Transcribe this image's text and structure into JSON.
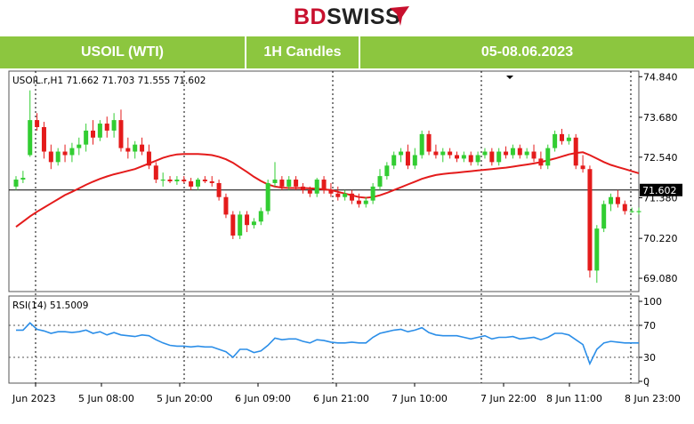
{
  "logo": {
    "part1": "BD",
    "part2": "SWISS"
  },
  "header": {
    "symbol": "USOIL (WTI)",
    "timeframe": "1H Candles",
    "date_range": "05-08.06.2023"
  },
  "colors": {
    "header_bg": "#8cc63f",
    "bull": "#32cd32",
    "bear": "#e41b1b",
    "ma": "#e41b1b",
    "rsi": "#2b8ee8",
    "price_line": "#000000"
  },
  "chart_data": [
    {
      "type": "candlestick",
      "title": "USOIL.r,H1  71.662 71.703 71.555 71.602",
      "current_price": 71.602,
      "current_price_label": "71.602",
      "ylim": [
        68.7,
        75.0
      ],
      "y_ticks": [
        "74.840",
        "73.680",
        "72.540",
        "71.380",
        "70.220",
        "69.080"
      ],
      "x_ticks": [
        "Jun 2023",
        "5 Jun 08:00",
        "5 Jun 20:00",
        "6 Jun 09:00",
        "6 Jun 21:00",
        "7 Jun 10:00",
        "7 Jun 22:00",
        "8 Jun 11:00",
        "8 Jun 23:00"
      ],
      "candles": [
        [
          71.7,
          72.0,
          71.6,
          71.9
        ],
        [
          71.9,
          72.15,
          71.8,
          71.95
        ],
        [
          72.6,
          74.45,
          72.55,
          73.6
        ],
        [
          73.6,
          73.8,
          73.3,
          73.4
        ],
        [
          73.4,
          73.55,
          72.5,
          72.7
        ],
        [
          72.7,
          72.9,
          72.2,
          72.4
        ],
        [
          72.4,
          72.8,
          72.3,
          72.7
        ],
        [
          72.7,
          72.9,
          72.4,
          72.6
        ],
        [
          72.6,
          72.95,
          72.4,
          72.8
        ],
        [
          72.8,
          73.1,
          72.6,
          72.9
        ],
        [
          72.9,
          73.5,
          72.7,
          73.3
        ],
        [
          73.3,
          73.6,
          72.9,
          73.1
        ],
        [
          73.1,
          73.6,
          73.0,
          73.5
        ],
        [
          73.5,
          73.7,
          73.1,
          73.3
        ],
        [
          73.3,
          73.8,
          73.1,
          73.6
        ],
        [
          73.6,
          73.9,
          72.7,
          72.8
        ],
        [
          72.8,
          73.1,
          72.5,
          72.7
        ],
        [
          72.7,
          73.0,
          72.5,
          72.9
        ],
        [
          72.9,
          73.1,
          72.6,
          72.7
        ],
        [
          72.7,
          72.9,
          72.2,
          72.3
        ],
        [
          72.3,
          72.4,
          71.8,
          71.9
        ],
        [
          71.9,
          72.1,
          71.7,
          71.9
        ],
        [
          71.9,
          72.0,
          71.8,
          71.85
        ],
        [
          71.85,
          72.0,
          71.75,
          71.9
        ],
        [
          71.9,
          72.0,
          71.8,
          71.85
        ],
        [
          71.85,
          71.95,
          71.6,
          71.7
        ],
        [
          71.7,
          71.95,
          71.6,
          71.9
        ],
        [
          71.9,
          72.0,
          71.8,
          71.85
        ],
        [
          71.85,
          72.0,
          71.7,
          71.8
        ],
        [
          71.8,
          71.9,
          71.3,
          71.4
        ],
        [
          71.4,
          71.5,
          70.8,
          70.9
        ],
        [
          70.9,
          71.0,
          70.2,
          70.3
        ],
        [
          70.3,
          71.0,
          70.2,
          70.9
        ],
        [
          70.9,
          71.0,
          70.4,
          70.6
        ],
        [
          70.6,
          70.8,
          70.5,
          70.7
        ],
        [
          70.7,
          71.1,
          70.6,
          71.0
        ],
        [
          71.0,
          71.9,
          70.9,
          71.8
        ],
        [
          71.8,
          72.4,
          71.7,
          71.9
        ],
        [
          71.9,
          72.0,
          71.6,
          71.7
        ],
        [
          71.7,
          72.0,
          71.6,
          71.9
        ],
        [
          71.9,
          72.0,
          71.6,
          71.7
        ],
        [
          71.7,
          71.8,
          71.5,
          71.6
        ],
        [
          71.6,
          71.7,
          71.4,
          71.5
        ],
        [
          71.5,
          71.95,
          71.4,
          71.9
        ],
        [
          71.9,
          72.0,
          71.5,
          71.6
        ],
        [
          71.6,
          71.8,
          71.4,
          71.5
        ],
        [
          71.5,
          71.7,
          71.3,
          71.4
        ],
        [
          71.4,
          71.6,
          71.3,
          71.5
        ],
        [
          71.5,
          71.6,
          71.2,
          71.3
        ],
        [
          71.3,
          71.5,
          71.1,
          71.2
        ],
        [
          71.2,
          71.4,
          71.1,
          71.3
        ],
        [
          71.3,
          71.8,
          71.2,
          71.7
        ],
        [
          71.7,
          72.2,
          71.6,
          72.0
        ],
        [
          72.0,
          72.4,
          71.9,
          72.3
        ],
        [
          72.3,
          72.7,
          72.2,
          72.6
        ],
        [
          72.6,
          72.8,
          72.4,
          72.7
        ],
        [
          72.7,
          72.9,
          72.2,
          72.3
        ],
        [
          72.3,
          72.8,
          72.2,
          72.6
        ],
        [
          72.6,
          73.3,
          72.5,
          73.2
        ],
        [
          73.2,
          73.3,
          72.6,
          72.7
        ],
        [
          72.7,
          72.9,
          72.5,
          72.6
        ],
        [
          72.6,
          72.8,
          72.4,
          72.7
        ],
        [
          72.7,
          72.8,
          72.5,
          72.6
        ],
        [
          72.6,
          72.7,
          72.4,
          72.5
        ],
        [
          72.5,
          72.7,
          72.4,
          72.6
        ],
        [
          72.6,
          72.7,
          72.3,
          72.4
        ],
        [
          72.4,
          72.7,
          72.3,
          72.6
        ],
        [
          72.6,
          72.8,
          72.5,
          72.7
        ],
        [
          72.7,
          72.8,
          72.3,
          72.4
        ],
        [
          72.4,
          72.8,
          72.3,
          72.7
        ],
        [
          72.7,
          72.85,
          72.5,
          72.6
        ],
        [
          72.6,
          72.9,
          72.5,
          72.8
        ],
        [
          72.8,
          72.9,
          72.5,
          72.6
        ],
        [
          72.6,
          72.8,
          72.5,
          72.7
        ],
        [
          72.7,
          72.9,
          72.4,
          72.5
        ],
        [
          72.5,
          72.7,
          72.2,
          72.3
        ],
        [
          72.3,
          72.9,
          72.2,
          72.8
        ],
        [
          72.8,
          73.3,
          72.7,
          73.2
        ],
        [
          73.2,
          73.35,
          72.9,
          73.0
        ],
        [
          73.0,
          73.2,
          72.9,
          73.1
        ],
        [
          73.1,
          73.2,
          72.2,
          72.3
        ],
        [
          72.3,
          72.6,
          72.1,
          72.2
        ],
        [
          72.2,
          72.3,
          69.1,
          69.3
        ],
        [
          69.3,
          70.6,
          68.95,
          70.5
        ],
        [
          70.5,
          71.3,
          70.4,
          71.2
        ],
        [
          71.2,
          71.5,
          71.0,
          71.4
        ],
        [
          71.4,
          71.6,
          71.1,
          71.2
        ],
        [
          71.2,
          71.3,
          70.9,
          71.0
        ],
        [
          71.0,
          71.1,
          70.95,
          71.0
        ],
        [
          71.0,
          71.1,
          70.9,
          71.0
        ]
      ],
      "moving_average": [
        70.55,
        70.7,
        70.85,
        70.98,
        71.1,
        71.22,
        71.34,
        71.46,
        71.55,
        71.65,
        71.75,
        71.84,
        71.92,
        71.99,
        72.05,
        72.1,
        72.15,
        72.2,
        72.28,
        72.36,
        72.44,
        72.52,
        72.58,
        72.62,
        72.63,
        72.63,
        72.63,
        72.62,
        72.6,
        72.55,
        72.48,
        72.38,
        72.25,
        72.12,
        71.98,
        71.86,
        71.76,
        71.7,
        71.67,
        71.66,
        71.66,
        71.66,
        71.65,
        71.64,
        71.62,
        71.6,
        71.55,
        71.5,
        71.45,
        71.4,
        71.38,
        71.4,
        71.45,
        71.52,
        71.6,
        71.68,
        71.76,
        71.84,
        71.92,
        71.98,
        72.03,
        72.06,
        72.08,
        72.1,
        72.12,
        72.14,
        72.16,
        72.18,
        72.2,
        72.22,
        72.24,
        72.27,
        72.3,
        72.33,
        72.36,
        72.4,
        72.45,
        72.5,
        72.56,
        72.62,
        72.66,
        72.68,
        72.6,
        72.5,
        72.4,
        72.32,
        72.26,
        72.2,
        72.14,
        72.08
      ]
    },
    {
      "type": "line",
      "title": "RSI(14) 51.5009",
      "ylim": [
        0,
        100
      ],
      "y_ticks": [
        "100",
        "70",
        "30",
        "0"
      ],
      "levels": [
        70,
        30
      ],
      "values": [
        64,
        64,
        73,
        65,
        63,
        60,
        62,
        62,
        61,
        62,
        64,
        60,
        62,
        58,
        61,
        58,
        57,
        56,
        58,
        57,
        52,
        48,
        45,
        44,
        44,
        43,
        44,
        43,
        43,
        40,
        37,
        30,
        40,
        40,
        36,
        38,
        45,
        54,
        52,
        53,
        53,
        50,
        48,
        52,
        51,
        49,
        48,
        48,
        49,
        48,
        48,
        55,
        60,
        62,
        64,
        65,
        62,
        64,
        67,
        61,
        58,
        57,
        57,
        57,
        55,
        53,
        55,
        57,
        53,
        55,
        55,
        56,
        53,
        54,
        55,
        52,
        55,
        60,
        60,
        58,
        52,
        46,
        22,
        40,
        48,
        50,
        49,
        48,
        48,
        48
      ]
    }
  ]
}
